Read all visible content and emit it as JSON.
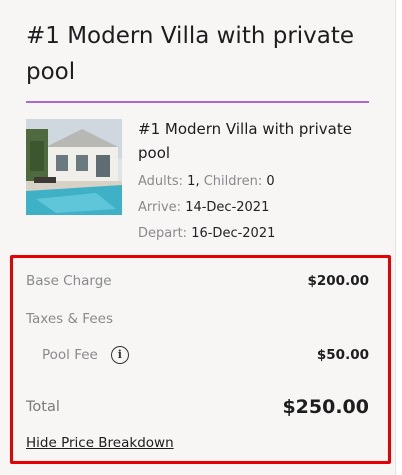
{
  "booking": {
    "title": "#1 Modern Villa with private pool",
    "room_name": "#1 Modern Villa with private pool",
    "adults_label": "Adults:",
    "adults_value": "1",
    "children_label": "Children:",
    "children_value": "0",
    "arrive_label": "Arrive:",
    "arrive_value": "14-Dec-2021",
    "depart_label": "Depart:",
    "depart_value": "16-Dec-2021"
  },
  "price": {
    "base_label": "Base Charge",
    "base_value": "$200.00",
    "taxes_label": "Taxes & Fees",
    "pool_label": "Pool Fee",
    "pool_value": "$50.00",
    "total_label": "Total",
    "total_value": "$250.00",
    "hide_link": "Hide Price Breakdown"
  },
  "icons": {
    "info": "info-icon"
  },
  "colors": {
    "accent_divider": "#a86bd6",
    "highlight_border": "#e60000"
  }
}
